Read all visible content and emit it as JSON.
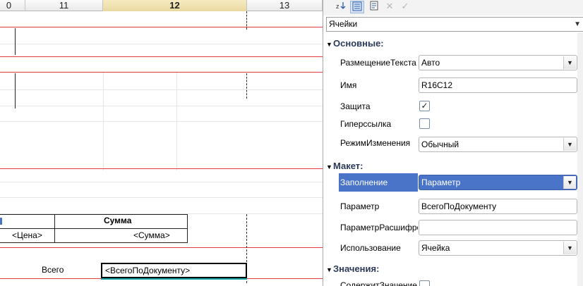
{
  "columns": [
    {
      "label": "0",
      "selected": false
    },
    {
      "label": "11",
      "selected": false
    },
    {
      "label": "12",
      "selected": true
    },
    {
      "label": "13",
      "selected": false
    }
  ],
  "sheet": {
    "header_amount": "Сумма",
    "price_param": "<Цена>",
    "amount_param": "<Сумма>",
    "total_label": "Всего",
    "active_cell_value": "<ВсегоПоДокументу>"
  },
  "toolbar": {
    "sort_icon": "sort-az-icon",
    "categories_icon": "categories-icon",
    "properties_icon": "properties-icon",
    "clear_icon": "clear-icon",
    "apply_icon": "apply-icon"
  },
  "object_select": {
    "value": "Ячейки"
  },
  "groups": {
    "basic": "Основные:",
    "layout": "Макет:",
    "values": "Значения:"
  },
  "props": {
    "placement": {
      "label": "РазмещениеТекста",
      "value": "Авто"
    },
    "name": {
      "label": "Имя",
      "value": "R16C12"
    },
    "protection": {
      "label": "Защита",
      "checked": true
    },
    "hyperlink": {
      "label": "Гиперссылка",
      "checked": false
    },
    "edit_mode": {
      "label": "РежимИзменения",
      "value": "Обычный"
    },
    "fill": {
      "label": "Заполнение",
      "value": "Параметр"
    },
    "parameter": {
      "label": "Параметр",
      "value": "ВсегоПоДокументу"
    },
    "decode_parameter": {
      "label": "ПараметрРасшифровки",
      "value": ""
    },
    "usage": {
      "label": "Использование",
      "value": "Ячейка"
    },
    "contains_value": {
      "label": "СодержитЗначение",
      "checked": false
    }
  },
  "colors": {
    "accent": "#4a74c7",
    "grid_red": "#e23a3a",
    "selected_column": "#f0e2b0"
  }
}
